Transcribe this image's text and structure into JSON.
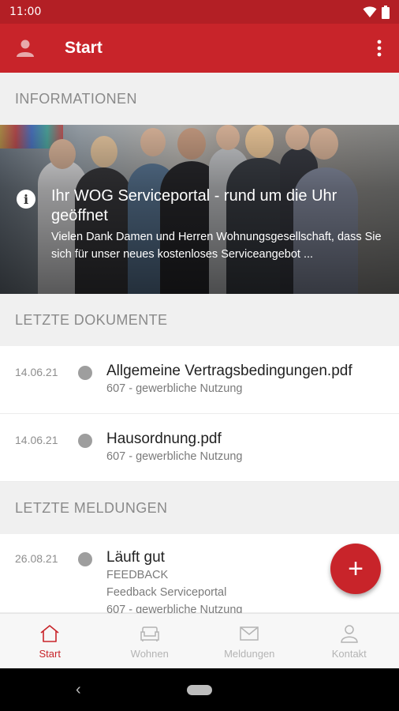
{
  "status_bar": {
    "time": "11:00"
  },
  "app_bar": {
    "title": "Start"
  },
  "informationen": {
    "header": "INFORMATIONEN",
    "card": {
      "title": "Ihr WOG Serviceportal - rund um die Uhr geöffnet",
      "text": "Vielen Dank Damen und Herren Wohnungsgesellschaft, dass Sie sich für unser neues kostenloses Serviceangebot ..."
    }
  },
  "dokumente": {
    "header": "LETZTE DOKUMENTE",
    "items": [
      {
        "date": "14.06.21",
        "title": "Allgemeine Vertragsbedingungen.pdf",
        "sub": "607 - gewerbliche Nutzung"
      },
      {
        "date": "14.06.21",
        "title": "Hausordnung.pdf",
        "sub": "607 - gewerbliche Nutzung"
      }
    ]
  },
  "meldungen": {
    "header": "LETZTE MELDUNGEN",
    "items": [
      {
        "date": "26.08.21",
        "title": "Läuft gut",
        "category": "FEEDBACK",
        "sub1": "Feedback Serviceportal",
        "sub2": "607 - gewerbliche Nutzung"
      }
    ]
  },
  "fab": {
    "label": "+"
  },
  "bottom_nav": {
    "items": [
      {
        "label": "Start",
        "icon": "home-icon",
        "active": true
      },
      {
        "label": "Wohnen",
        "icon": "sofa-icon",
        "active": false
      },
      {
        "label": "Meldungen",
        "icon": "mail-icon",
        "active": false
      },
      {
        "label": "Kontakt",
        "icon": "person-icon",
        "active": false
      }
    ]
  },
  "colors": {
    "primary": "#c8242a",
    "status_bar": "#b31f25",
    "inactive": "#b4b4b4"
  }
}
